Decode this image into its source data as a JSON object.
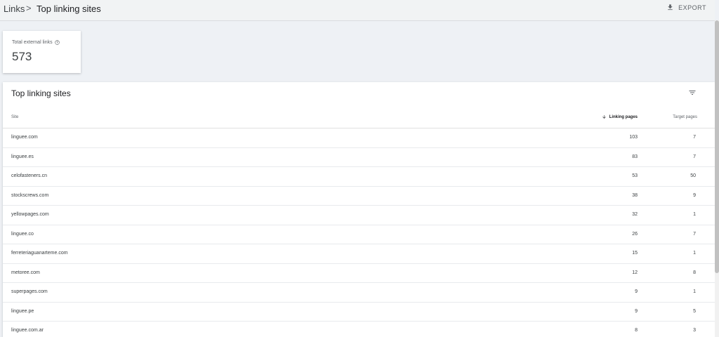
{
  "breadcrumb": {
    "parent": "Links",
    "separator": ">",
    "current": "Top linking sites"
  },
  "toolbar": {
    "export_label": "EXPORT"
  },
  "summary": {
    "label": "Total external links",
    "value": "573"
  },
  "table": {
    "title": "Top linking sites",
    "columns": {
      "site": "Site",
      "linking_pages": "Linking pages",
      "target_pages": "Target pages"
    },
    "rows": [
      {
        "site": "linguee.com",
        "linking": "103",
        "target": "7"
      },
      {
        "site": "linguee.es",
        "linking": "83",
        "target": "7"
      },
      {
        "site": "celofasteners.cn",
        "linking": "53",
        "target": "50"
      },
      {
        "site": "stockscrews.com",
        "linking": "38",
        "target": "9"
      },
      {
        "site": "yellowpages.com",
        "linking": "32",
        "target": "1"
      },
      {
        "site": "linguee.co",
        "linking": "26",
        "target": "7"
      },
      {
        "site": "ferreteriaguanarteme.com",
        "linking": "15",
        "target": "1"
      },
      {
        "site": "metoree.com",
        "linking": "12",
        "target": "8"
      },
      {
        "site": "superpages.com",
        "linking": "9",
        "target": "1"
      },
      {
        "site": "linguee.pe",
        "linking": "9",
        "target": "5"
      },
      {
        "site": "linguee.com.ar",
        "linking": "8",
        "target": "3"
      }
    ]
  },
  "icons": {
    "export": "download-icon",
    "help": "help-circle-icon",
    "filter": "filter-icon",
    "sort": "arrow-down-icon"
  },
  "colors": {
    "page_bg": "#eef1f5",
    "card_bg": "#ffffff",
    "text": "#202124",
    "muted": "#5f6368"
  }
}
